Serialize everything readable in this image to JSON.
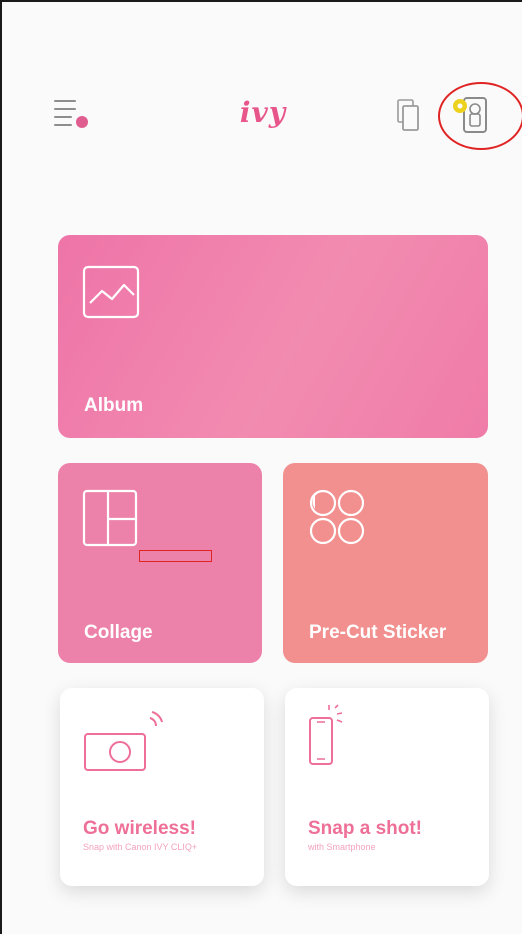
{
  "header": {
    "logo": "ivy",
    "menu_icon": "hamburger-menu-with-notification-dot-icon",
    "gallery_icon": "stacked-photos-icon",
    "printer_icon": "printer-status-icon"
  },
  "tiles": {
    "album": {
      "label": "Album",
      "icon": "image-icon"
    },
    "collage": {
      "label": "Collage",
      "icon": "collage-grid-icon"
    },
    "sticker": {
      "label": "Pre-Cut Sticker",
      "icon": "sticker-circles-icon"
    },
    "wireless": {
      "title": "Go wireless!",
      "subtitle": "Snap with Canon IVY CLIQ+",
      "icon": "wireless-camera-icon"
    },
    "snap": {
      "title": "Snap a shot!",
      "subtitle": "with Smartphone",
      "icon": "smartphone-icon"
    }
  },
  "colors": {
    "accent": "#e8558a",
    "album": "#ee74a8",
    "collage": "#ec82aa",
    "sticker": "#f1908f",
    "annotation": "#e02424"
  }
}
